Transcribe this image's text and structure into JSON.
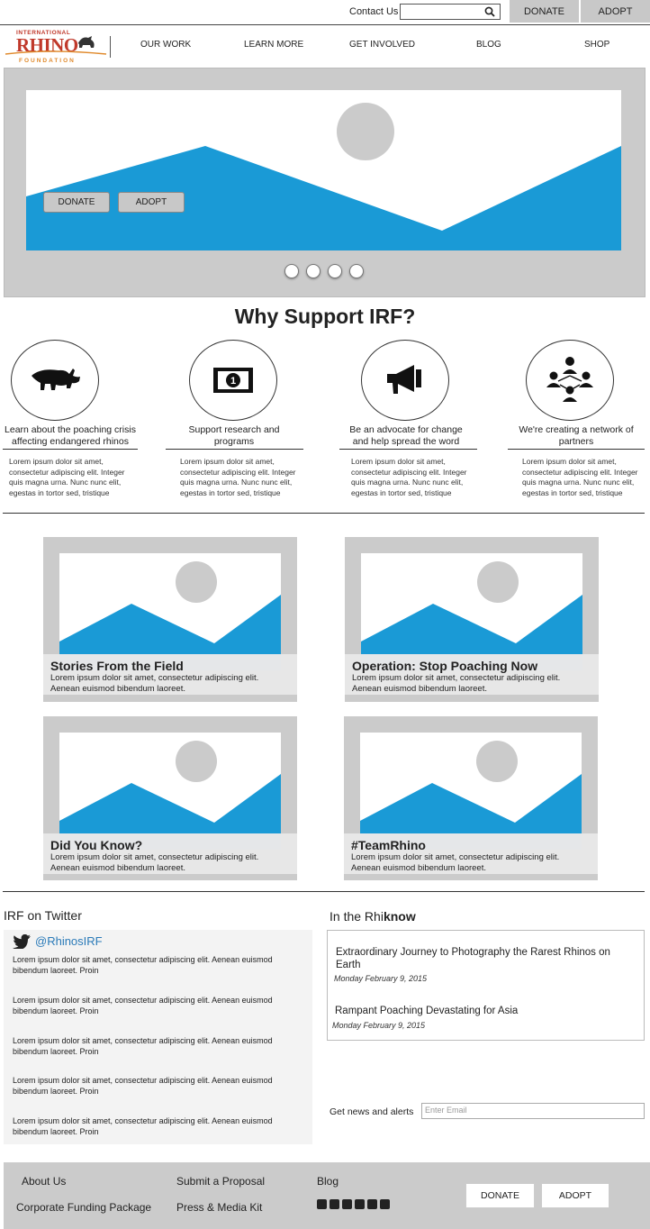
{
  "top": {
    "contact": "Contact Us",
    "search_placeholder": "",
    "donate": "DONATE",
    "adopt": "ADOPT"
  },
  "logo": {
    "line1": "INTERNATIONAL",
    "line2": "RHINO",
    "line3": "FOUNDATION"
  },
  "nav": [
    "OUR WORK",
    "LEARN MORE",
    "GET INVOLVED",
    "BLOG",
    "SHOP"
  ],
  "hero": {
    "donate": "DONATE",
    "adopt": "ADOPT",
    "slides": 4
  },
  "why": {
    "title": "Why Support IRF?",
    "items": [
      {
        "label": "Learn about the poaching crisis affecting endangered rhinos",
        "text": "Lorem ipsum dolor sit amet, consectetur adipiscing elit. Integer quis magna urna. Nunc nunc elit, egestas in tortor sed, tristique",
        "icon": "rhino-icon"
      },
      {
        "label": "Support research and programs",
        "text": "Lorem ipsum dolor sit amet, consectetur adipiscing elit. Integer quis magna urna. Nunc nunc elit, egestas in tortor sed, tristique",
        "icon": "money-icon"
      },
      {
        "label": "Be an advocate for change and help spread the word",
        "text": "Lorem ipsum dolor sit amet, consectetur adipiscing elit. Integer quis magna urna. Nunc nunc elit, egestas in tortor sed, tristique",
        "icon": "megaphone-icon"
      },
      {
        "label": "We're creating a network of partners",
        "text": "Lorem ipsum dolor sit amet, consectetur adipiscing elit. Integer quis magna urna. Nunc nunc elit, egestas in tortor sed, tristique",
        "icon": "network-icon"
      }
    ]
  },
  "cards": [
    {
      "title": "Stories From the Field",
      "text": "Lorem ipsum dolor sit amet, consectetur adipiscing elit. Aenean euismod bibendum laoreet."
    },
    {
      "title": "Operation: Stop Poaching Now",
      "text": "Lorem ipsum dolor sit amet, consectetur adipiscing elit. Aenean euismod bibendum laoreet."
    },
    {
      "title": "Did You Know?",
      "text": "Lorem ipsum dolor sit amet, consectetur adipiscing elit. Aenean euismod bibendum laoreet."
    },
    {
      "title": "#TeamRhino",
      "text": "Lorem ipsum dolor sit amet, consectetur adipiscing elit. Aenean euismod bibendum laoreet."
    }
  ],
  "twitter": {
    "title": "IRF on Twitter",
    "handle": "@RhinosIRF",
    "tweets": [
      "Lorem ipsum dolor sit amet, consectetur adipiscing elit. Aenean euismod bibendum laoreet. Proin",
      "Lorem ipsum dolor sit amet, consectetur adipiscing elit. Aenean euismod bibendum laoreet. Proin",
      "Lorem ipsum dolor sit amet, consectetur adipiscing elit. Aenean euismod bibendum laoreet. Proin",
      "Lorem ipsum dolor sit amet, consectetur adipiscing elit. Aenean euismod bibendum laoreet. Proin",
      "Lorem ipsum dolor sit amet, consectetur adipiscing elit. Aenean euismod bibendum laoreet. Proin"
    ]
  },
  "rhiknow": {
    "title_a": "In the Rhi",
    "title_b": "know",
    "articles": [
      {
        "headline": "Extraordinary Journey to Photography the Rarest Rhinos on Earth",
        "date": "Monday February 9, 2015"
      },
      {
        "headline": "Rampant Poaching Devastating for Asia",
        "date": "Monday February 9, 2015"
      }
    ],
    "news_label": "Get news and alerts",
    "email_placeholder": "Enter Email"
  },
  "footer": {
    "about": "About Us",
    "corporate": "Corporate Funding Package",
    "proposal": "Submit a Proposal",
    "press": "Press & Media Kit",
    "blog": "Blog",
    "donate": "DONATE",
    "adopt": "ADOPT",
    "social_icons": [
      "twitter-icon",
      "facebook-icon",
      "pinterest-icon",
      "youtube-icon",
      "flickr-icon",
      "rss-icon"
    ]
  },
  "colors": {
    "accent_blue": "#1a9ad6",
    "placeholder_gray": "#cbcbcb",
    "caption_blue": "#a6d5ef"
  }
}
